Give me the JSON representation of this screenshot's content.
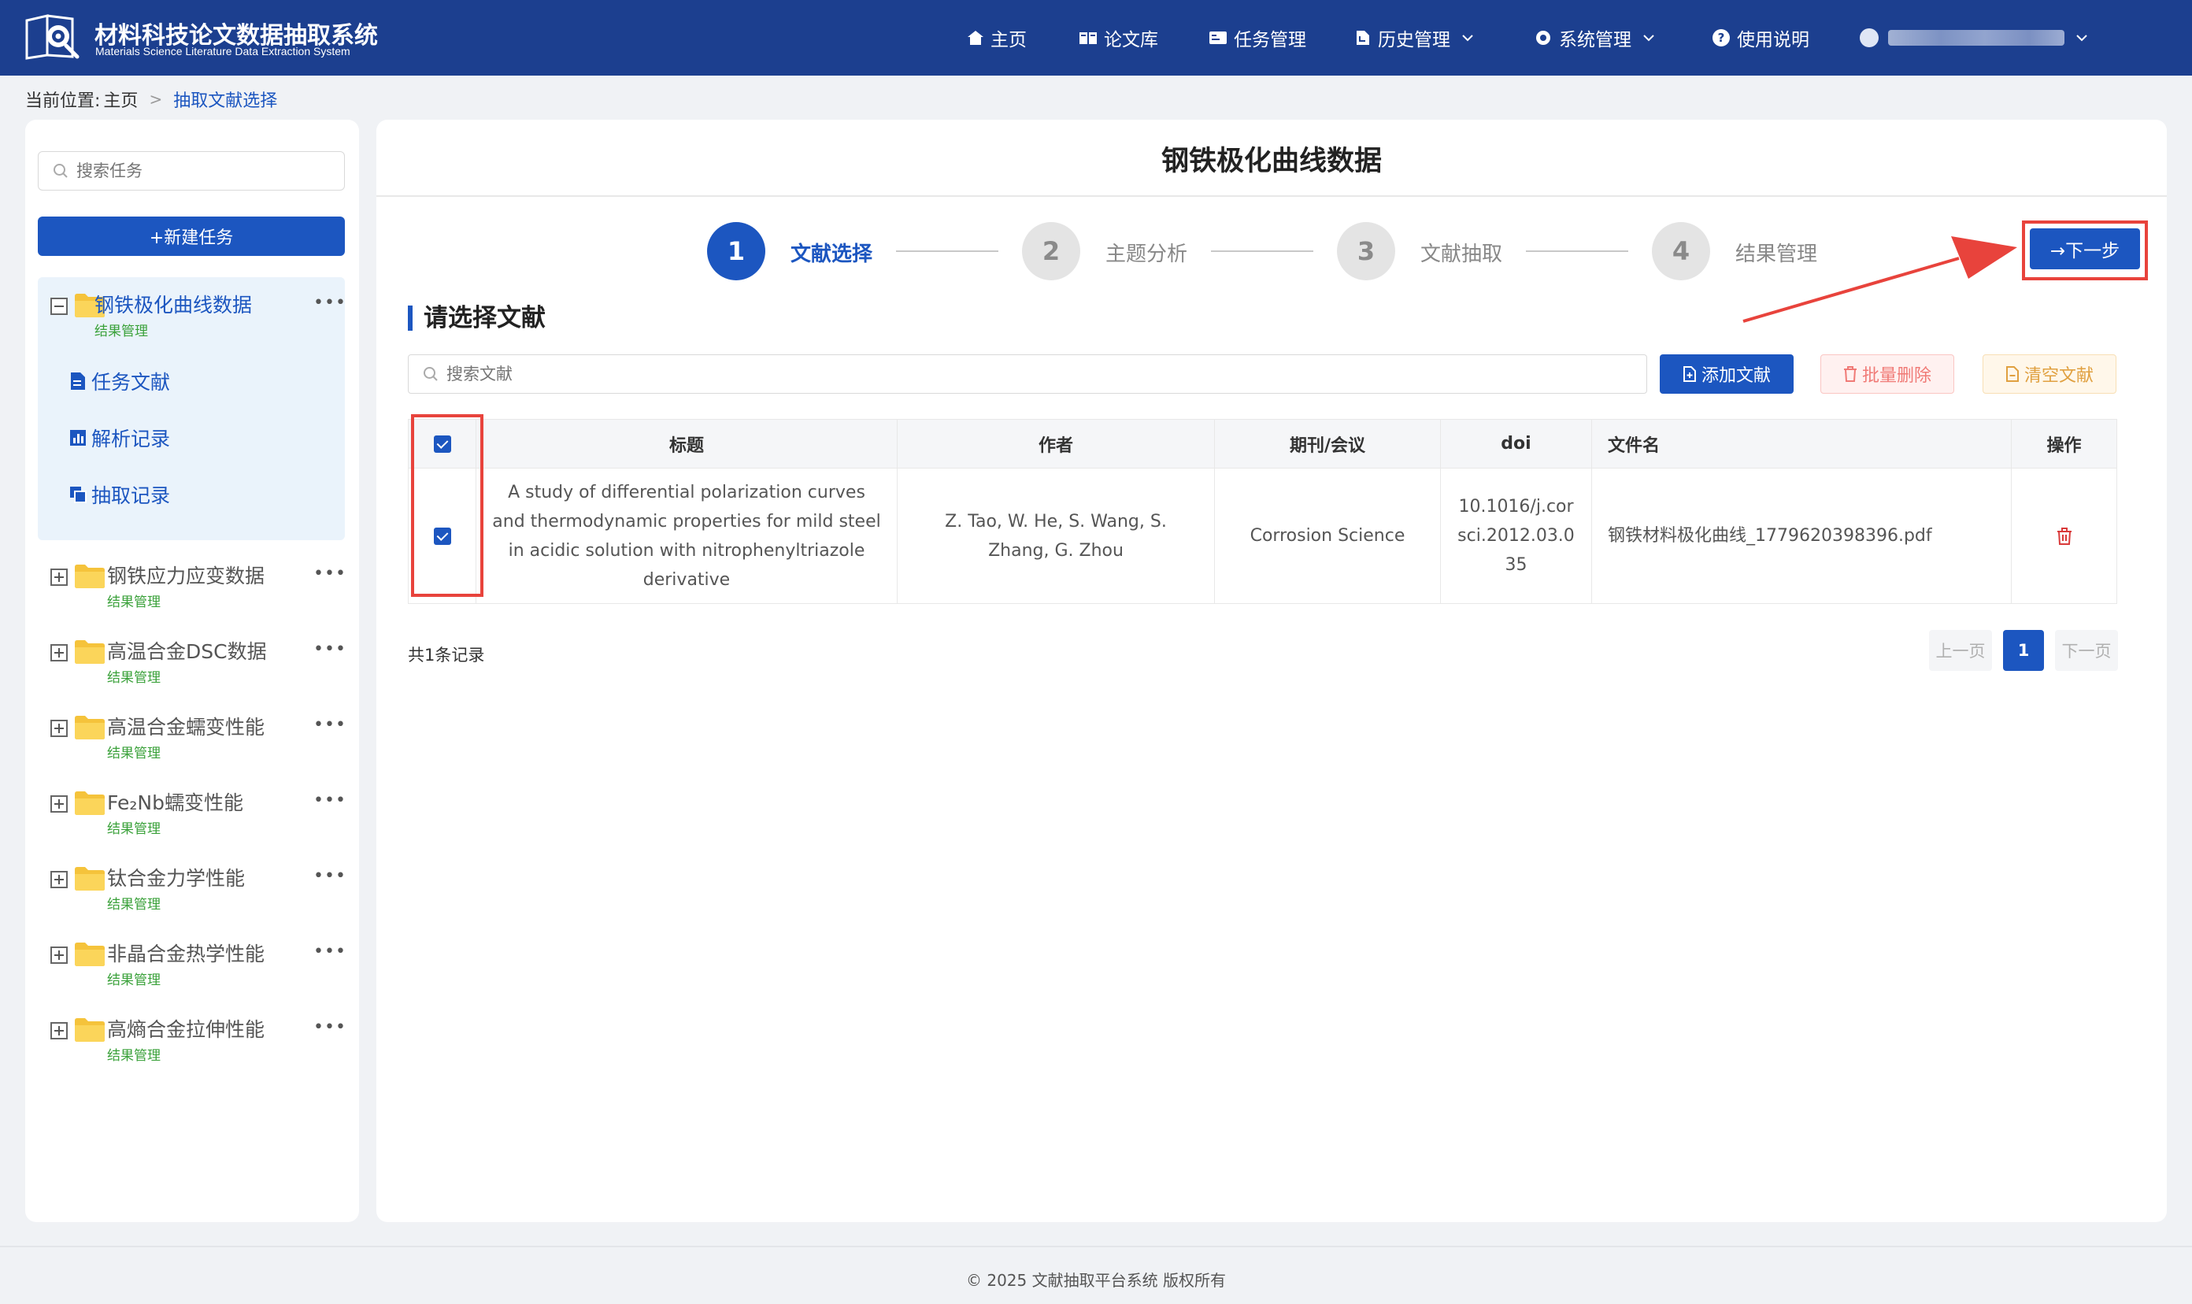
{
  "header": {
    "title": "材料科技论文数据抽取系统",
    "subtitle": "Materials Science Literature Data Extraction System",
    "nav": [
      {
        "label": "主页",
        "icon": "home-icon"
      },
      {
        "label": "论文库",
        "icon": "book-icon"
      },
      {
        "label": "任务管理",
        "icon": "task-icon"
      },
      {
        "label": "历史管理",
        "icon": "history-icon"
      },
      {
        "label": "系统管理",
        "icon": "gear-icon"
      },
      {
        "label": "使用说明",
        "icon": "help-icon"
      }
    ]
  },
  "breadcrumb": {
    "prefix": "当前位置:",
    "home": "主页",
    "current": "抽取文献选择"
  },
  "sidebar": {
    "search_placeholder": "搜索任务",
    "new_task_label": "+新建任务",
    "tasks": [
      {
        "name": "钢铁极化曲线数据",
        "tag": "结果管理"
      },
      {
        "name": "钢铁应力应变数据",
        "tag": "结果管理"
      },
      {
        "name": "高温合金DSC数据",
        "tag": "结果管理"
      },
      {
        "name": "高温合金蠕变性能",
        "tag": "结果管理"
      },
      {
        "name": "Fe₂Nb蠕变性能",
        "tag": "结果管理"
      },
      {
        "name": "钛合金力学性能",
        "tag": "结果管理"
      },
      {
        "name": "非晶合金热学性能",
        "tag": "结果管理"
      },
      {
        "name": "高熵合金拉伸性能",
        "tag": "结果管理"
      }
    ],
    "sub_items": [
      {
        "label": "任务文献",
        "icon": "document-icon"
      },
      {
        "label": "解析记录",
        "icon": "chart-icon"
      },
      {
        "label": "抽取记录",
        "icon": "copy-icon"
      }
    ]
  },
  "main": {
    "title": "钢铁极化曲线数据",
    "steps": [
      {
        "num": "1",
        "label": "文献选择"
      },
      {
        "num": "2",
        "label": "主题分析"
      },
      {
        "num": "3",
        "label": "文献抽取"
      },
      {
        "num": "4",
        "label": "结果管理"
      }
    ],
    "next_label": "→下一步",
    "section_title": "请选择文献",
    "search_placeholder": "搜索文献",
    "buttons": {
      "add": "添加文献",
      "batch_delete": "批量删除",
      "clear": "清空文献"
    },
    "table": {
      "headers": [
        "标题",
        "作者",
        "期刊/会议",
        "doi",
        "文件名",
        "操作"
      ],
      "rows": [
        {
          "title": "A study of differential polarization curves and thermodynamic properties for mild steel in acidic solution with nitrophenyltriazole derivative",
          "authors": "Z. Tao, W. He, S. Wang, S. Zhang, G. Zhou",
          "journal": "Corrosion Science",
          "doi": "10.1016/j.corsci.2012.03.035",
          "filename": "钢铁材料极化曲线_1779620398396.pdf"
        }
      ]
    },
    "total": "共1条记录",
    "pagination": {
      "prev": "上一页",
      "current": "1",
      "next": "下一页"
    }
  },
  "footer": "© 2025 文献抽取平台系统 版权所有",
  "colors": {
    "primary": "#1c56c0",
    "header": "#1c3f8f",
    "highlight": "#e8433c",
    "tag": "#3aa13a"
  }
}
